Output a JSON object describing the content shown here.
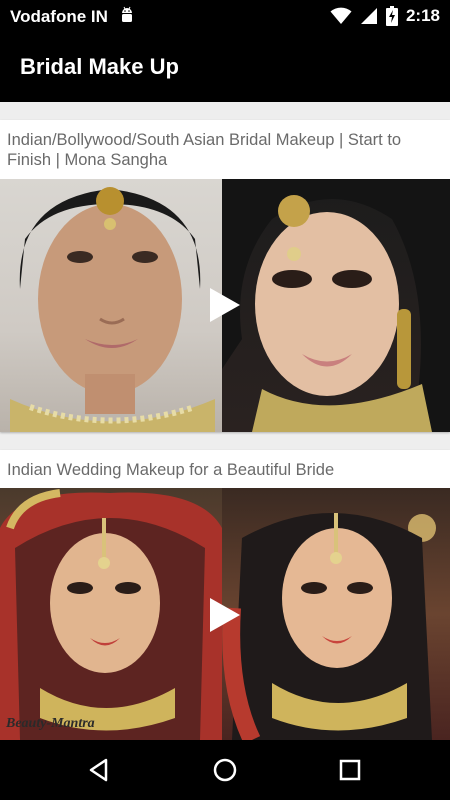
{
  "status_bar": {
    "carrier": "Vodafone IN",
    "time": "2:18",
    "icons": [
      "android-notification-icon",
      "wifi-icon",
      "cell-signal-icon",
      "battery-charging-icon"
    ]
  },
  "app_bar": {
    "title": "Bridal Make Up"
  },
  "videos": [
    {
      "title": "Indian/Bollywood/South Asian Bridal Makeup | Start to Finish | Mona Sangha",
      "thumbnail": "before-after-bridal-makeup-thumbnail",
      "icon": "play-icon"
    },
    {
      "title": "Indian Wedding Makeup for a Beautiful Bride",
      "thumbnail": "indian-wedding-makeup-thumbnail",
      "watermark": "Beauty-Mantra",
      "icon": "play-icon"
    }
  ],
  "nav_bar": {
    "icons": [
      "back-icon",
      "home-icon",
      "recents-icon"
    ]
  }
}
